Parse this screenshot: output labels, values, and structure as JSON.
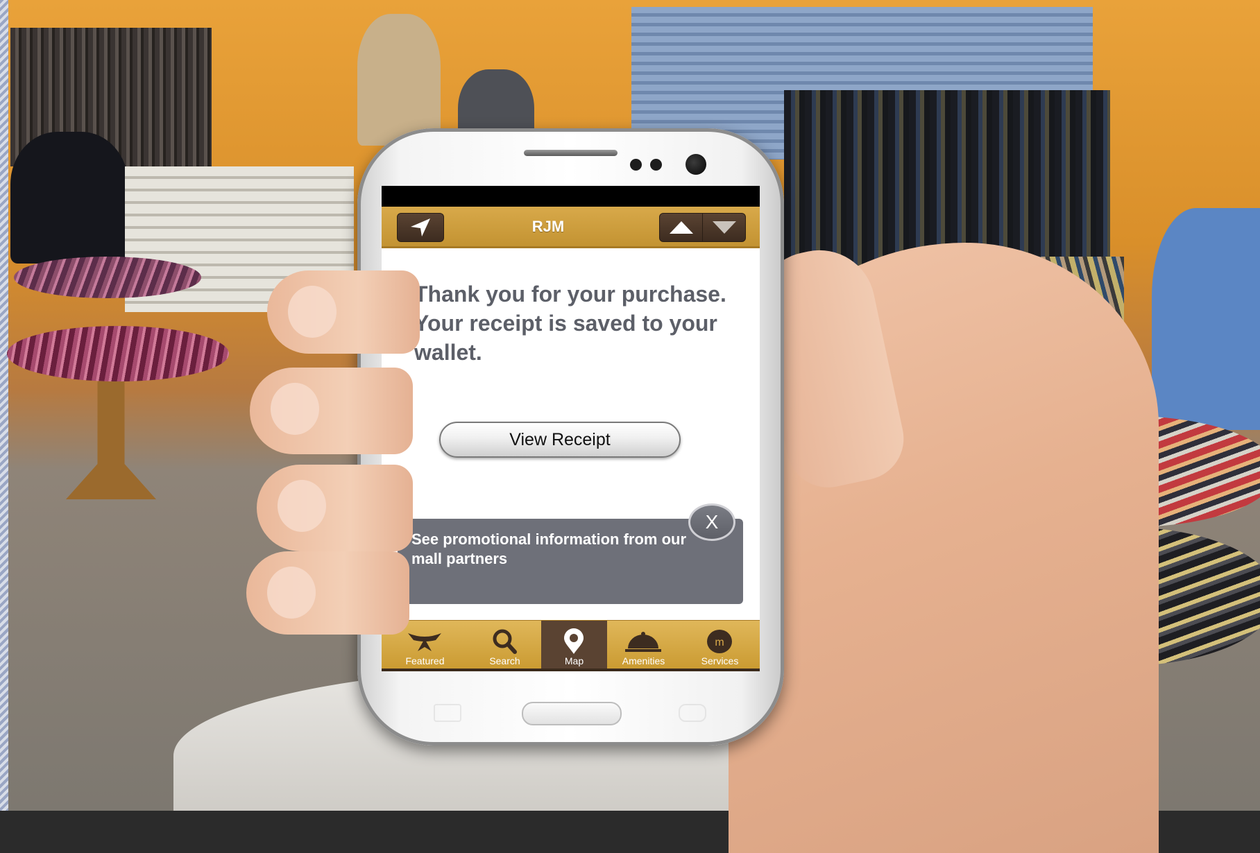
{
  "app": {
    "title": "RJM"
  },
  "header": {
    "nav_icon": "location-arrow-icon",
    "up_icon": "arrow-up-icon",
    "down_icon": "arrow-down-icon"
  },
  "main": {
    "message": "Thank you for your purchase. Your receipt is saved to your wallet.",
    "receipt_button_label": "View Receipt"
  },
  "promo": {
    "text": "See promotional information from our mall partners",
    "close_label": "X"
  },
  "tabs": [
    {
      "label": "Featured",
      "icon": "featured-icon",
      "active": false
    },
    {
      "label": "Search",
      "icon": "search-icon",
      "active": false
    },
    {
      "label": "Map",
      "icon": "map-pin-icon",
      "active": true
    },
    {
      "label": "Amenities",
      "icon": "service-bell-icon",
      "active": false
    },
    {
      "label": "Services",
      "icon": "mall-logo-icon",
      "active": false
    }
  ],
  "colors": {
    "header_gold": "#c9992f",
    "active_tab": "#5a4332",
    "promo_gray": "#6e7079",
    "message_text": "#5c5f68"
  }
}
